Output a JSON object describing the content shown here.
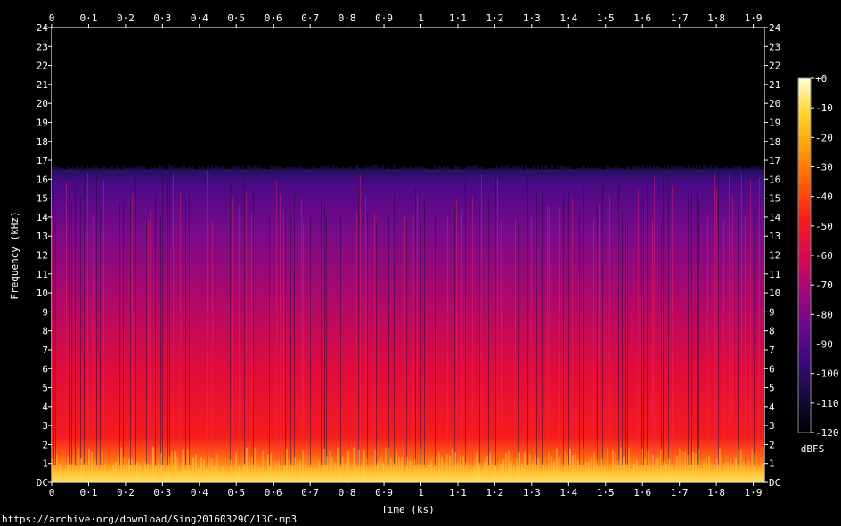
{
  "chart_data": {
    "type": "heatmap",
    "title": "",
    "xlabel": "Time (ks)",
    "ylabel": "Frequency (kHz)",
    "x_ticks": [
      "0",
      "0·1",
      "0·2",
      "0·3",
      "0·4",
      "0·5",
      "0·6",
      "0·7",
      "0·8",
      "0·9",
      "1",
      "1·1",
      "1·2",
      "1·3",
      "1·4",
      "1·5",
      "1·6",
      "1·7",
      "1·8",
      "1·9"
    ],
    "x_range": [
      0,
      1.93
    ],
    "y_ticks": [
      "DC",
      "1",
      "2",
      "3",
      "4",
      "5",
      "6",
      "7",
      "8",
      "9",
      "10",
      "11",
      "12",
      "13",
      "14",
      "15",
      "16",
      "17",
      "18",
      "19",
      "20",
      "21",
      "22",
      "23",
      "24"
    ],
    "y_range": [
      0,
      24
    ],
    "frequency_cutoff_khz": 16.5,
    "colorbar": {
      "label": "dBFS",
      "ticks": [
        "+0",
        "-10",
        "-20",
        "-30",
        "-40",
        "-50",
        "-60",
        "-70",
        "-80",
        "-90",
        "-100",
        "-110",
        "-120"
      ],
      "range": [
        -120,
        0
      ],
      "colors": [
        "#000000",
        "#140a3c",
        "#3a0a78",
        "#6a0a8c",
        "#a0087a",
        "#d80a50",
        "#f41c1c",
        "#ff5a0a",
        "#ff9c0a",
        "#ffd42a",
        "#ffffd8"
      ]
    },
    "intensity_profile": [
      {
        "freq_khz": 0.3,
        "dbfs": -10
      },
      {
        "freq_khz": 1,
        "dbfs": -28
      },
      {
        "freq_khz": 2,
        "dbfs": -42
      },
      {
        "freq_khz": 4,
        "dbfs": -52
      },
      {
        "freq_khz": 6,
        "dbfs": -58
      },
      {
        "freq_khz": 9,
        "dbfs": -66
      },
      {
        "freq_khz": 12,
        "dbfs": -76
      },
      {
        "freq_khz": 15,
        "dbfs": -88
      },
      {
        "freq_khz": 16.5,
        "dbfs": -100
      },
      {
        "freq_khz": 17,
        "dbfs": -120
      }
    ]
  },
  "source_url": "https://archive·org/download/Sing20160329C/13C·mp3"
}
